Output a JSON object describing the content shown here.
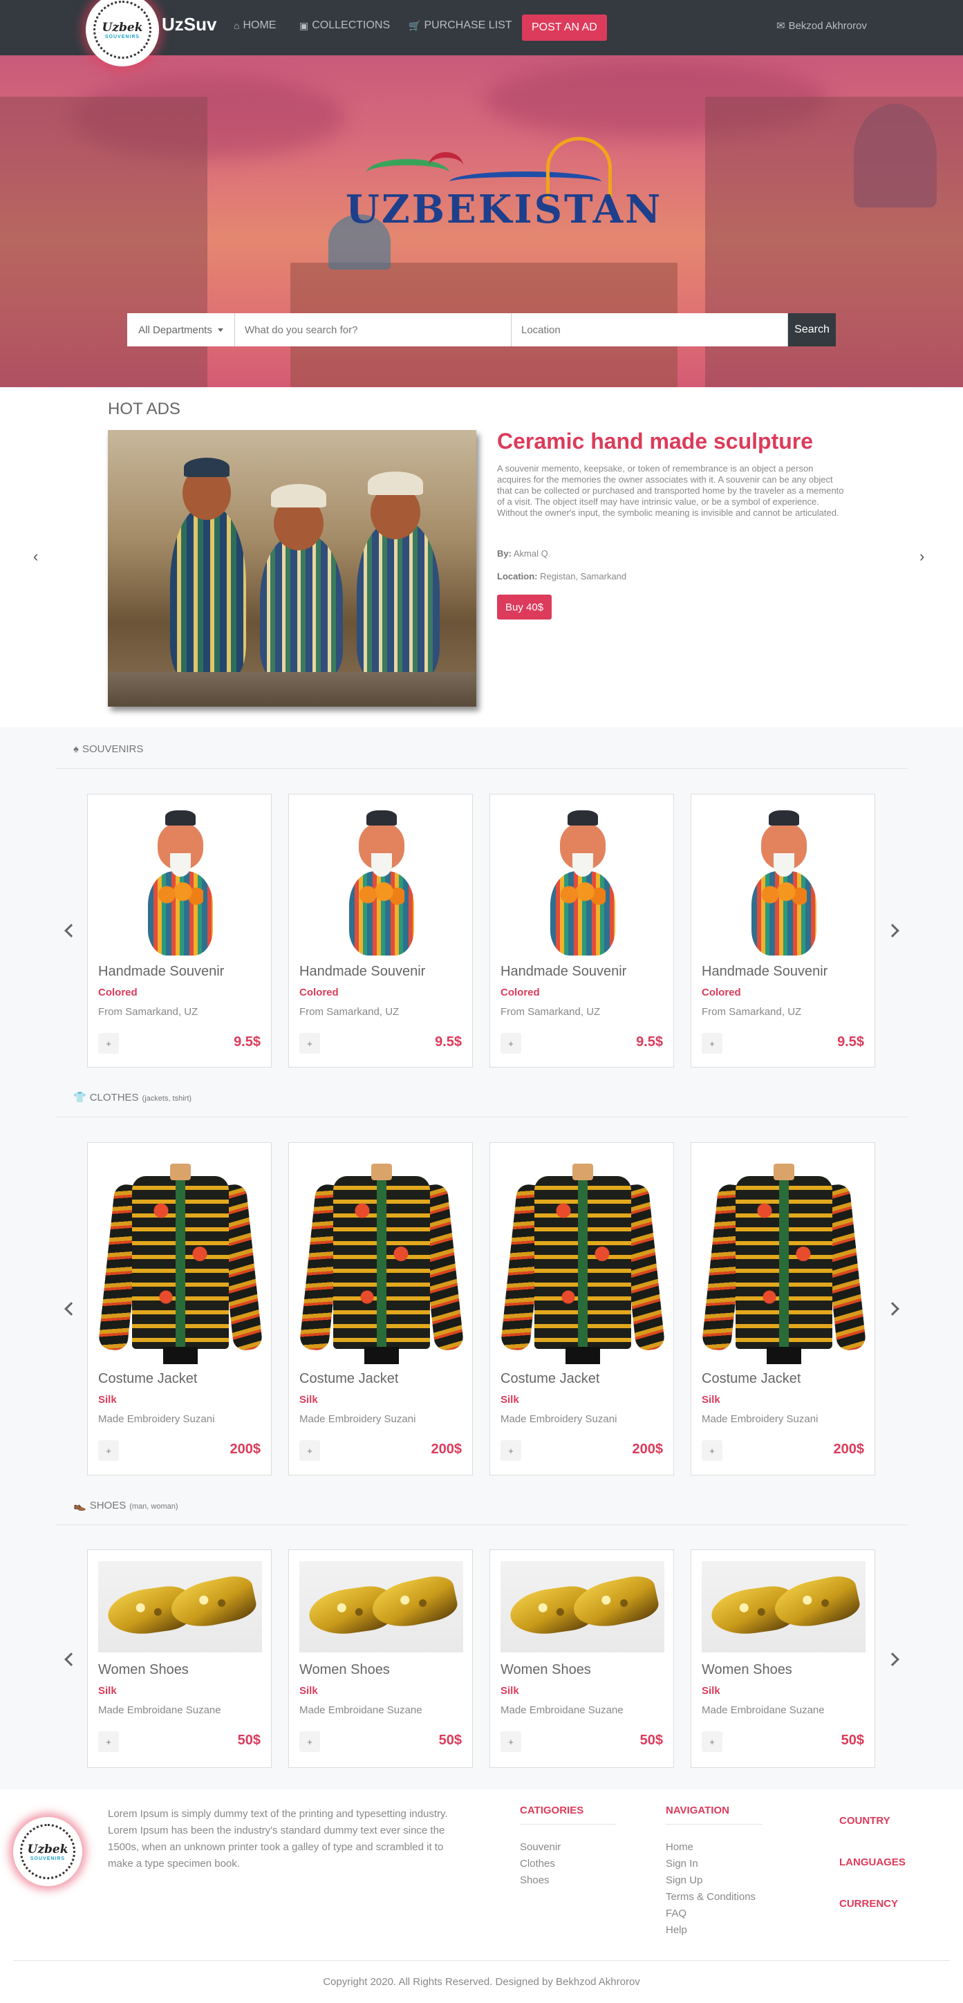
{
  "brand": {
    "logo_text": "Uzbek",
    "logo_sub": "SOUVENIRS",
    "name": "UzSuv"
  },
  "nav": {
    "home": "HOME",
    "collections": "COLLECTIONS",
    "purchase_list": "PURCHASE LIST",
    "post_ad": "POST AN AD",
    "user": "Bekzod Akhrorov"
  },
  "hero": {
    "title": "UZBEKISTAN",
    "search": {
      "department": "All Departments",
      "query_placeholder": "What do you search for?",
      "location_placeholder": "Location",
      "button": "Search"
    }
  },
  "hot_ads": {
    "section_title": "HOT ADS",
    "title": "Ceramic hand made sculpture",
    "description": "A souvenir memento, keepsake, or token of remembrance is an object a person acquires for the memories the owner associates with it. A souvenir can be any object that can be collected or purchased and transported home by the traveler as a memento of a visit. The object itself may have intrinsic value, or be a symbol of experience. Without the owner's input, the symbolic meaning is invisible and cannot be articulated.",
    "by_label": "By:",
    "by_value": "Akmal Q.",
    "location_label": "Location:",
    "location_value": "Registan, Samarkand",
    "buy_button": "Buy 40$"
  },
  "sections": {
    "souvenirs": {
      "title": "SOUVENIRS",
      "subtitle": "",
      "items": [
        {
          "name": "Handmade Souvenir",
          "tag": "Colored",
          "origin": "From Samarkand, UZ",
          "price": "9.5$",
          "add": "+"
        },
        {
          "name": "Handmade Souvenir",
          "tag": "Colored",
          "origin": "From Samarkand, UZ",
          "price": "9.5$",
          "add": "+"
        },
        {
          "name": "Handmade Souvenir",
          "tag": "Colored",
          "origin": "From Samarkand, UZ",
          "price": "9.5$",
          "add": "+"
        },
        {
          "name": "Handmade Souvenir",
          "tag": "Colored",
          "origin": "From Samarkand, UZ",
          "price": "9.5$",
          "add": "+"
        }
      ]
    },
    "clothes": {
      "title": "CLOTHES",
      "subtitle": "(jackets, tshirt)",
      "items": [
        {
          "name": "Costume Jacket",
          "tag": "Silk",
          "origin": "Made Embroidery Suzani",
          "price": "200$",
          "add": "+"
        },
        {
          "name": "Costume Jacket",
          "tag": "Silk",
          "origin": "Made Embroidery Suzani",
          "price": "200$",
          "add": "+"
        },
        {
          "name": "Costume Jacket",
          "tag": "Silk",
          "origin": "Made Embroidery Suzani",
          "price": "200$",
          "add": "+"
        },
        {
          "name": "Costume Jacket",
          "tag": "Silk",
          "origin": "Made Embroidery Suzani",
          "price": "200$",
          "add": "+"
        }
      ]
    },
    "shoes": {
      "title": "SHOES",
      "subtitle": "(man, woman)",
      "items": [
        {
          "name": "Women Shoes",
          "tag": "Silk",
          "origin": "Made Embroidane Suzane",
          "price": "50$",
          "add": "+"
        },
        {
          "name": "Women Shoes",
          "tag": "Silk",
          "origin": "Made Embroidane Suzane",
          "price": "50$",
          "add": "+"
        },
        {
          "name": "Women Shoes",
          "tag": "Silk",
          "origin": "Made Embroidane Suzane",
          "price": "50$",
          "add": "+"
        },
        {
          "name": "Women Shoes",
          "tag": "Silk",
          "origin": "Made Embroidane Suzane",
          "price": "50$",
          "add": "+"
        }
      ]
    }
  },
  "footer": {
    "description": "Lorem Ipsum is simply dummy text of the printing and typesetting industry. Lorem Ipsum has been the industry's standard dummy text ever since the 1500s, when an unknown printer took a galley of type and scrambled it to make a type specimen book.",
    "categories_title": "CATIGORIES",
    "categories": [
      "Souvenir",
      "Clothes",
      "Shoes"
    ],
    "navigation_title": "NAVIGATION",
    "navigation": [
      "Home",
      "Sign In",
      "Sign Up",
      "Terms & Conditions",
      "FAQ",
      "Help"
    ],
    "country": "COUNTRY",
    "languages": "LANGUAGES",
    "currency": "CURRENCY",
    "copyright": "Copyright 2020. All Rights Reserved. Designed by Bekhzod Akhrorov"
  },
  "colors": {
    "accent": "#dc3b5b",
    "navbar": "#343a40"
  }
}
